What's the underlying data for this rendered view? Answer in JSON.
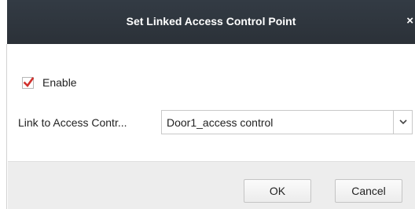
{
  "dialog": {
    "title": "Set Linked Access Control Point",
    "close_icon": "close-icon"
  },
  "enable": {
    "label": "Enable",
    "checked": true,
    "check_color": "#d0312d"
  },
  "link": {
    "label": "Link to Access Contr...",
    "selected_value": "Door1_access control",
    "arrow_icon": "chevron-down-icon"
  },
  "buttons": {
    "ok_label": "OK",
    "cancel_label": "Cancel"
  },
  "colors": {
    "titlebar": "#2e353d",
    "footer": "#ededed"
  }
}
